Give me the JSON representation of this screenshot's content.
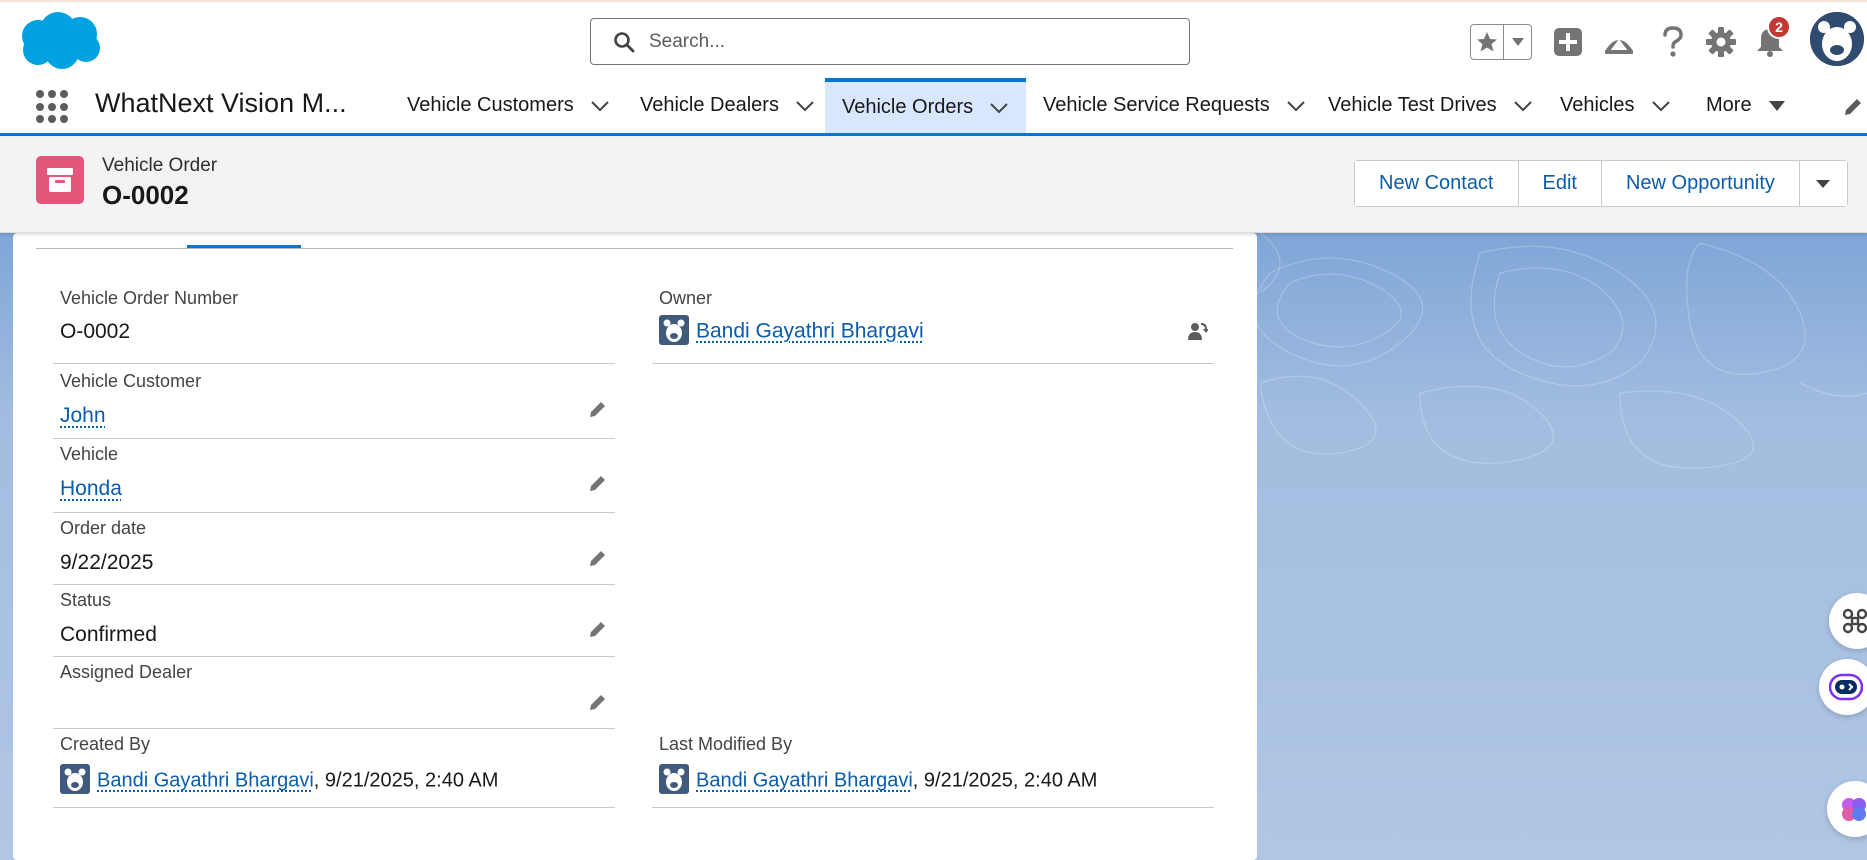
{
  "header": {
    "search_placeholder": "Search...",
    "notification_count": "2"
  },
  "nav": {
    "app_name": "WhatNext Vision M...",
    "tabs": [
      {
        "label": "Vehicle Customers"
      },
      {
        "label": "Vehicle Dealers"
      },
      {
        "label": "Vehicle Orders"
      },
      {
        "label": "Vehicle Service Requests"
      },
      {
        "label": "Vehicle Test Drives"
      },
      {
        "label": "Vehicles"
      },
      {
        "label": "More"
      }
    ]
  },
  "record": {
    "type": "Vehicle Order",
    "title": "O-0002",
    "actions": {
      "new_contact": "New Contact",
      "edit": "Edit",
      "new_opportunity": "New Opportunity"
    }
  },
  "fields": {
    "order_number": {
      "label": "Vehicle Order Number",
      "value": "O-0002"
    },
    "owner": {
      "label": "Owner",
      "value": "Bandi Gayathri Bhargavi"
    },
    "customer": {
      "label": "Vehicle Customer",
      "value": "John"
    },
    "vehicle": {
      "label": "Vehicle",
      "value": "Honda"
    },
    "order_date": {
      "label": "Order date",
      "value": "9/22/2025"
    },
    "status": {
      "label": "Status",
      "value": "Confirmed"
    },
    "assigned_dealer": {
      "label": "Assigned Dealer",
      "value": ""
    },
    "created_by": {
      "label": "Created By",
      "user": "Bandi Gayathri Bhargavi",
      "date": "9/21/2025, 2:40 AM"
    },
    "last_modified_by": {
      "label": "Last Modified By",
      "user": "Bandi Gayathri Bhargavi",
      "date": "9/21/2025, 2:40 AM"
    }
  },
  "colors": {
    "brand": "#0176d3",
    "record_icon": "#e3577b",
    "link": "#0b5cab",
    "notification_badge": "#c23934"
  }
}
